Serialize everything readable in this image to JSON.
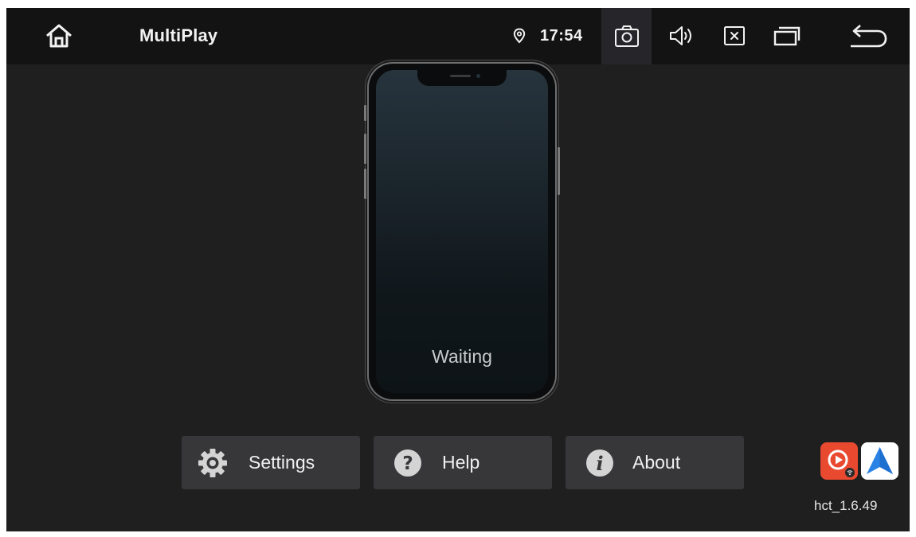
{
  "statusbar": {
    "app_title": "MultiPlay",
    "time": "17:54",
    "icons": [
      "home-icon",
      "location-pin-icon",
      "screenshot-icon",
      "volume-icon",
      "close-app-icon",
      "recent-apps-icon",
      "back-icon"
    ]
  },
  "phone": {
    "status_text": "Waiting"
  },
  "actions": {
    "settings_label": "Settings",
    "help_label": "Help",
    "about_label": "About"
  },
  "apps": [
    "carplay-icon",
    "android-auto-icon"
  ],
  "version": "hct_1.6.49",
  "colors": {
    "background": "#1f1f20",
    "statusbar": "#131314",
    "button": "#37373a",
    "carplay_red": "#e8492f",
    "android_auto_blue": "#2a82e4"
  }
}
